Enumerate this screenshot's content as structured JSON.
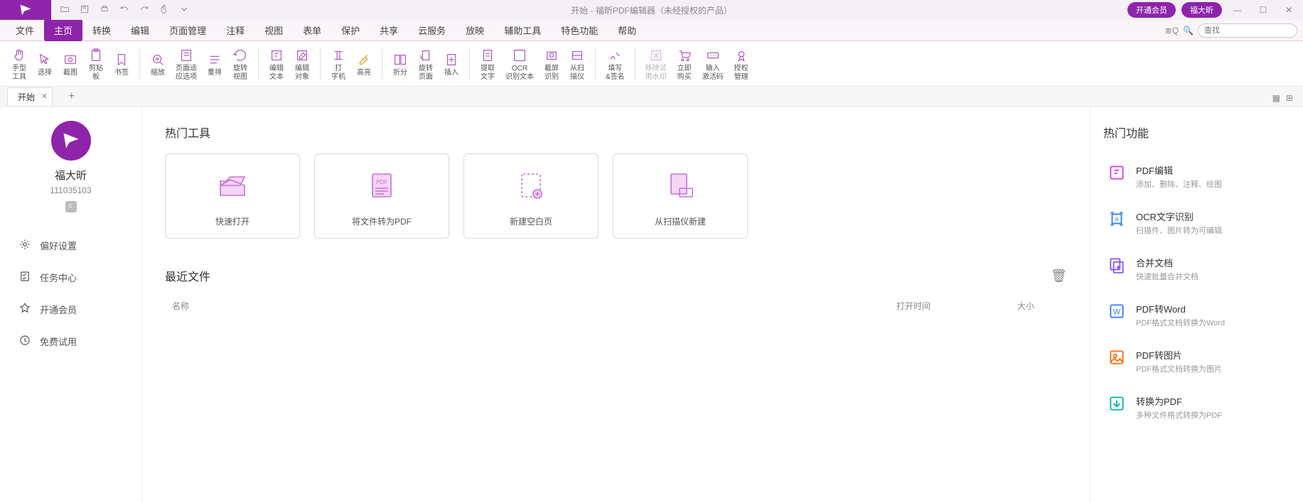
{
  "title": "开始 - 福昕PDF编辑器（未经授权的产品）",
  "titlebar": {
    "vip_button": "开通会员",
    "user_button": "福大昕"
  },
  "menu": [
    "文件",
    "主页",
    "转换",
    "编辑",
    "页面管理",
    "注释",
    "视图",
    "表单",
    "保护",
    "共享",
    "云服务",
    "放映",
    "辅助工具",
    "特色功能",
    "帮助"
  ],
  "menu_active_index": 1,
  "search_placeholder": "查找",
  "ribbon": [
    {
      "id": "hand",
      "label": "手型\n工具"
    },
    {
      "id": "select",
      "label": "选择"
    },
    {
      "id": "screenshot",
      "label": "截图"
    },
    {
      "id": "clipboard",
      "label": "剪贴\n板"
    },
    {
      "id": "bookmark",
      "label": "书签"
    },
    {
      "sep": true
    },
    {
      "id": "zoom",
      "label": "缩放"
    },
    {
      "id": "fitpage",
      "label": "页面适\n应选项"
    },
    {
      "id": "reflow",
      "label": "重排"
    },
    {
      "id": "rotateview",
      "label": "旋转\n视图"
    },
    {
      "sep": true
    },
    {
      "id": "edittext",
      "label": "编辑\n文本"
    },
    {
      "id": "editobj",
      "label": "编辑\n对象"
    },
    {
      "sep": true
    },
    {
      "id": "typewriter",
      "label": "打\n字机"
    },
    {
      "id": "highlight",
      "label": "高亮"
    },
    {
      "sep": true
    },
    {
      "id": "split",
      "label": "折分"
    },
    {
      "id": "rotatepage",
      "label": "旋转\n页面"
    },
    {
      "id": "insert",
      "label": "插入"
    },
    {
      "sep": true
    },
    {
      "id": "extract",
      "label": "提取\n文字"
    },
    {
      "id": "ocr",
      "label": "OCR\n识别文本"
    },
    {
      "id": "snap",
      "label": "截屏\n识别"
    },
    {
      "id": "scan",
      "label": "从扫\n描仪"
    },
    {
      "sep": true
    },
    {
      "id": "fillsign",
      "label": "填写\n&签名"
    },
    {
      "sep": true
    },
    {
      "id": "trywm",
      "label": "移除试\n用水印",
      "disabled": true
    },
    {
      "id": "buy",
      "label": "立即\n购买"
    },
    {
      "id": "activate",
      "label": "输入\n激活码"
    },
    {
      "id": "license",
      "label": "授权\n管理"
    }
  ],
  "tab": {
    "label": "开始"
  },
  "user": {
    "name": "福大昕",
    "id": "111035103",
    "badge": "F"
  },
  "sidebar": [
    {
      "id": "prefs",
      "label": "偏好设置"
    },
    {
      "id": "tasks",
      "label": "任务中心"
    },
    {
      "id": "vip",
      "label": "开通会员"
    },
    {
      "id": "trial",
      "label": "免费试用"
    }
  ],
  "main": {
    "tools_title": "热门工具",
    "cards": [
      {
        "id": "open",
        "label": "快速打开"
      },
      {
        "id": "convert",
        "label": "将文件转为PDF"
      },
      {
        "id": "blank",
        "label": "新建空白页"
      },
      {
        "id": "fromscan",
        "label": "从扫描仪新建"
      }
    ],
    "recent_title": "最近文件",
    "cols": {
      "name": "名称",
      "time": "打开时间",
      "size": "大小"
    }
  },
  "rightpanel": {
    "title": "热门功能",
    "features": [
      {
        "id": "edit",
        "title": "PDF编辑",
        "sub": "添加、删除、注释、绘图",
        "color": "#d946ef"
      },
      {
        "id": "ocr",
        "title": "OCR文字识别",
        "sub": "扫描件、图片转为可编辑",
        "color": "#3b82f6"
      },
      {
        "id": "merge",
        "title": "合并文档",
        "sub": "快速批量合并文档",
        "color": "#8b5cf6"
      },
      {
        "id": "toword",
        "title": "PDF转Word",
        "sub": "PDF格式文档转换为Word",
        "color": "#3b82f6"
      },
      {
        "id": "toimg",
        "title": "PDF转图片",
        "sub": "PDF格式文档转换为图片",
        "color": "#f97316"
      },
      {
        "id": "topdf",
        "title": "转换为PDF",
        "sub": "多种文件格式转换为PDF",
        "color": "#14b8a6"
      }
    ]
  }
}
